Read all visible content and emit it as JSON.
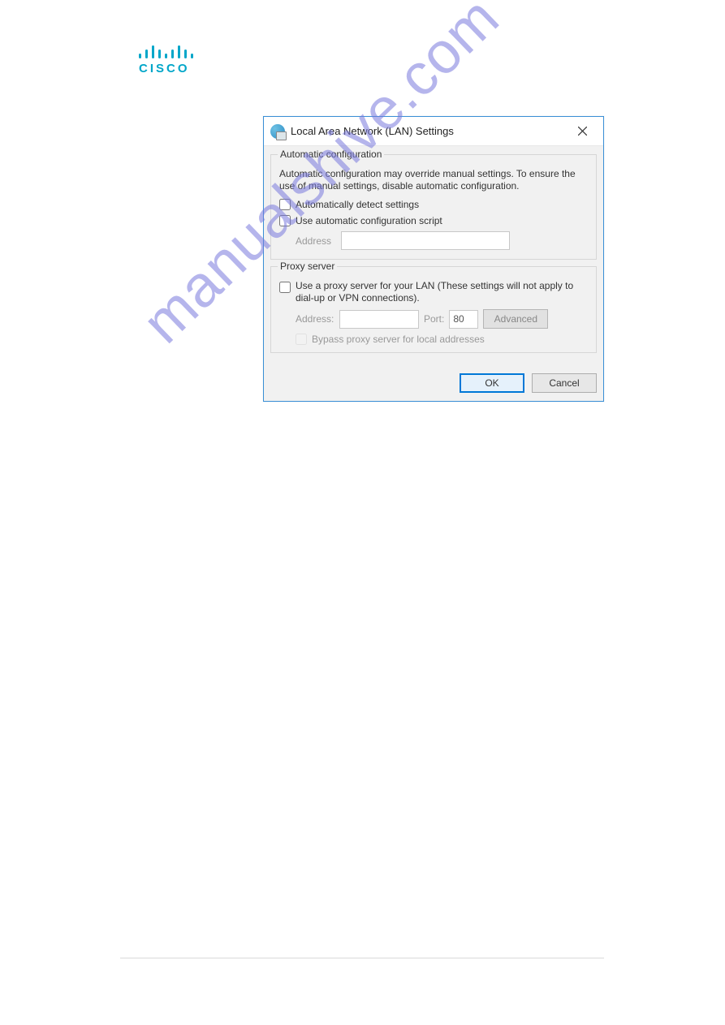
{
  "logo": {
    "brand": "CISCO"
  },
  "dialog": {
    "title": "Local Area Network (LAN) Settings",
    "autoconfig": {
      "legend": "Automatic configuration",
      "description": "Automatic configuration may override manual settings.  To ensure the use of manual settings, disable automatic configuration.",
      "auto_detect_label": "Automatically detect settings",
      "use_script_label": "Use automatic configuration script",
      "address_label": "Address",
      "address_value": ""
    },
    "proxy": {
      "legend": "Proxy server",
      "use_proxy_label": "Use a proxy server for your LAN (These settings will not apply to dial-up or VPN connections).",
      "address_label": "Address:",
      "address_value": "",
      "port_label": "Port:",
      "port_value": "80",
      "advanced_label": "Advanced",
      "bypass_label": "Bypass proxy server for local addresses"
    },
    "buttons": {
      "ok": "OK",
      "cancel": "Cancel"
    }
  },
  "watermark": "manualshive.com"
}
